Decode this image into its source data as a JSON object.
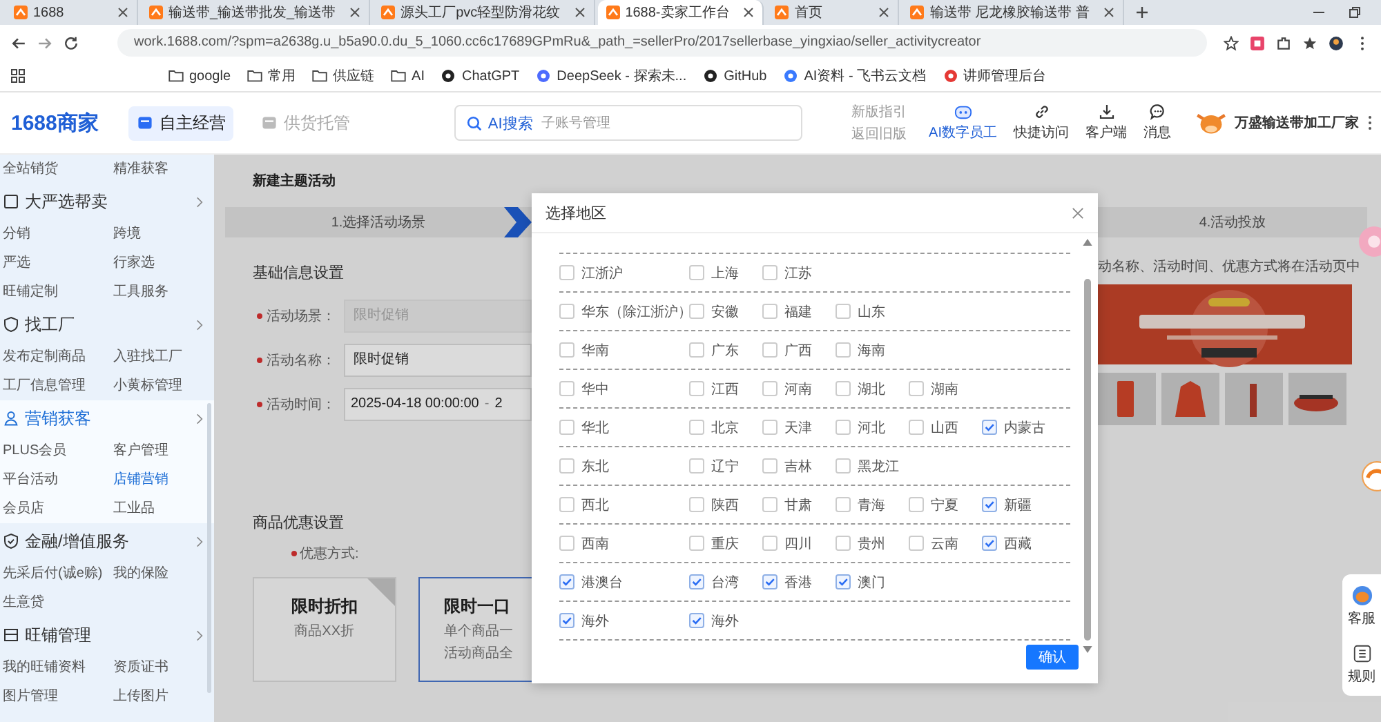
{
  "browser": {
    "tabs": [
      {
        "title": "1688",
        "selected": false
      },
      {
        "title": "输送带_输送带批发_输送带",
        "selected": false
      },
      {
        "title": "源头工厂pvc轻型防滑花纹",
        "selected": false
      },
      {
        "title": "1688-卖家工作台",
        "selected": true
      },
      {
        "title": "首页",
        "selected": false
      },
      {
        "title": "输送带 尼龙橡胶输送带 普",
        "selected": false
      }
    ],
    "url": "work.1688.com/?spm=a2638g.u_b5a90.0.du_5_1060.cc6c17689GPmRu&_path_=sellerPro/2017sellerbase_yingxiao/seller_activitycreator",
    "bookmarks": [
      {
        "label": "google",
        "kind": "folder"
      },
      {
        "label": "常用",
        "kind": "folder"
      },
      {
        "label": "供应链",
        "kind": "folder"
      },
      {
        "label": "AI",
        "kind": "folder"
      },
      {
        "label": "ChatGPT",
        "kind": "site"
      },
      {
        "label": "DeepSeek - 探索未...",
        "kind": "site"
      },
      {
        "label": "GitHub",
        "kind": "site"
      },
      {
        "label": "AI资料 - 飞书云文档",
        "kind": "site"
      },
      {
        "label": "讲师管理后台",
        "kind": "site"
      }
    ]
  },
  "header": {
    "logo": "1688商家",
    "nav": [
      {
        "label": "自主经营",
        "selected": true
      },
      {
        "label": "供货托管",
        "selected": false
      }
    ],
    "search": {
      "button": "AI搜索",
      "placeholder": "子账号管理"
    },
    "version_links": [
      "新版指引",
      "返回旧版"
    ],
    "tools": [
      "AI数字员工",
      "快捷访问",
      "客户端",
      "消息"
    ],
    "shop_name": "万盛输送带加工厂家"
  },
  "sidebar": {
    "top_items": [
      {
        "label": "全站销货",
        "selected": false
      },
      {
        "label": "精准获客",
        "selected": false
      }
    ],
    "groups": [
      {
        "title": "大严选帮卖",
        "selected": false,
        "items": [
          {
            "label": "分销",
            "selected": false
          },
          {
            "label": "跨境",
            "selected": false
          },
          {
            "label": "严选",
            "selected": false
          },
          {
            "label": "行家选",
            "selected": false
          },
          {
            "label": "旺铺定制",
            "selected": false
          },
          {
            "label": "工具服务",
            "selected": false
          }
        ]
      },
      {
        "title": "找工厂",
        "selected": false,
        "items": [
          {
            "label": "发布定制商品",
            "selected": false
          },
          {
            "label": "入驻找工厂",
            "selected": false
          },
          {
            "label": "工厂信息管理",
            "selected": false
          },
          {
            "label": "小黄标管理",
            "selected": false
          }
        ]
      },
      {
        "title": "营销获客",
        "selected": true,
        "items": [
          {
            "label": "PLUS会员",
            "selected": false
          },
          {
            "label": "客户管理",
            "selected": false
          },
          {
            "label": "平台活动",
            "selected": false
          },
          {
            "label": "店铺营销",
            "selected": true
          },
          {
            "label": "会员店",
            "selected": false
          },
          {
            "label": "工业品",
            "selected": false
          }
        ]
      },
      {
        "title": "金融/增值服务",
        "selected": false,
        "items": [
          {
            "label": "先采后付(诚e赊)",
            "selected": false
          },
          {
            "label": "我的保险",
            "selected": false
          },
          {
            "label": "生意贷",
            "selected": false
          }
        ]
      },
      {
        "title": "旺铺管理",
        "selected": false,
        "items": [
          {
            "label": "我的旺铺资料",
            "selected": false
          },
          {
            "label": "资质证书",
            "selected": false
          },
          {
            "label": "图片管理",
            "selected": false
          },
          {
            "label": "上传图片",
            "selected": false
          }
        ]
      }
    ]
  },
  "main": {
    "title": "新建主题活动",
    "steps": [
      {
        "label": "1.选择活动场景"
      },
      {
        "label": "4.活动投放"
      }
    ],
    "basic_title": "基础信息设置",
    "fields": [
      {
        "label": "活动场景：",
        "value": "限时促销",
        "required": true,
        "disabled": true,
        "kind": "text"
      },
      {
        "label": "活动名称：",
        "value": "限时促销",
        "required": true,
        "disabled": false,
        "kind": "text"
      },
      {
        "label": "活动时间：",
        "value": "2025-04-18 00:00:00",
        "separator": "-",
        "end_value": "2",
        "required": true,
        "disabled": false,
        "kind": "range"
      }
    ],
    "discount_title": "商品优惠设置",
    "discount_label": "优惠方式:",
    "discount_required": true,
    "cards": [
      {
        "title": "限时折扣",
        "lines": [
          "商品XX折"
        ],
        "selected": false
      },
      {
        "title": "限时一口",
        "lines": [
          "单个商品一",
          "活动商品全"
        ],
        "selected": true
      }
    ],
    "preview_hint": "动名称、活动时间、优惠方式将在活动页中"
  },
  "modal": {
    "title": "选择地区",
    "rows": [
      {
        "group": {
          "label": "江浙沪",
          "checked": false
        },
        "regions": [
          {
            "label": "上海",
            "checked": false
          },
          {
            "label": "江苏",
            "checked": false
          }
        ]
      },
      {
        "group": {
          "label": "华东（除江浙沪）",
          "checked": false
        },
        "regions": [
          {
            "label": "安徽",
            "checked": false
          },
          {
            "label": "福建",
            "checked": false
          },
          {
            "label": "山东",
            "checked": false
          }
        ]
      },
      {
        "group": {
          "label": "华南",
          "checked": false
        },
        "regions": [
          {
            "label": "广东",
            "checked": false
          },
          {
            "label": "广西",
            "checked": false
          },
          {
            "label": "海南",
            "checked": false
          }
        ]
      },
      {
        "group": {
          "label": "华中",
          "checked": false
        },
        "regions": [
          {
            "label": "江西",
            "checked": false
          },
          {
            "label": "河南",
            "checked": false
          },
          {
            "label": "湖北",
            "checked": false
          },
          {
            "label": "湖南",
            "checked": false
          }
        ]
      },
      {
        "group": {
          "label": "华北",
          "checked": false
        },
        "regions": [
          {
            "label": "北京",
            "checked": false
          },
          {
            "label": "天津",
            "checked": false
          },
          {
            "label": "河北",
            "checked": false
          },
          {
            "label": "山西",
            "checked": false
          },
          {
            "label": "内蒙古",
            "checked": true
          }
        ]
      },
      {
        "group": {
          "label": "东北",
          "checked": false
        },
        "regions": [
          {
            "label": "辽宁",
            "checked": false
          },
          {
            "label": "吉林",
            "checked": false
          },
          {
            "label": "黑龙江",
            "checked": false
          }
        ]
      },
      {
        "group": {
          "label": "西北",
          "checked": false
        },
        "regions": [
          {
            "label": "陕西",
            "checked": false
          },
          {
            "label": "甘肃",
            "checked": false
          },
          {
            "label": "青海",
            "checked": false
          },
          {
            "label": "宁夏",
            "checked": false
          },
          {
            "label": "新疆",
            "checked": true
          }
        ]
      },
      {
        "group": {
          "label": "西南",
          "checked": false
        },
        "regions": [
          {
            "label": "重庆",
            "checked": false
          },
          {
            "label": "四川",
            "checked": false
          },
          {
            "label": "贵州",
            "checked": false
          },
          {
            "label": "云南",
            "checked": false
          },
          {
            "label": "西藏",
            "checked": true
          }
        ]
      },
      {
        "group": {
          "label": "港澳台",
          "checked": true
        },
        "regions": [
          {
            "label": "台湾",
            "checked": true
          },
          {
            "label": "香港",
            "checked": true
          },
          {
            "label": "澳门",
            "checked": true
          }
        ]
      },
      {
        "group": {
          "label": "海外",
          "checked": true
        },
        "regions": [
          {
            "label": "海外",
            "checked": true
          }
        ]
      }
    ],
    "confirm": "确认"
  },
  "float_panel": [
    "客服",
    "规则"
  ]
}
